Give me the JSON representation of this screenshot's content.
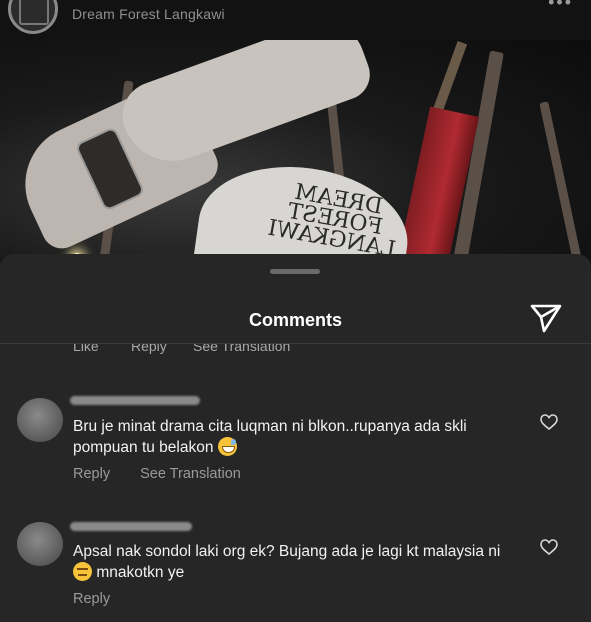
{
  "post": {
    "location": "Dream Forest Langkawi",
    "more_icon": "more-horizontal-icon"
  },
  "photo": {
    "cap_text": "DREAM FOREST LANGKAWI"
  },
  "sheet": {
    "title": "Comments",
    "send_icon": "send-icon",
    "clipped_actions": [
      "Like",
      "Reply",
      "See Translation"
    ]
  },
  "comments": [
    {
      "text_before_emoji": "Bru je minat drama cita luqman ni blkon..rupanya ada skli pompuan tu belakon",
      "emoji": "grinning-sweat-emoji",
      "text_after_emoji": "",
      "actions": [
        "Reply",
        "See Translation"
      ],
      "like_icon": "heart-icon"
    },
    {
      "text_before_emoji": "Apsal nak sondol laki org ek? Bujang ada je lagi kt malaysia ni",
      "emoji": "unamused-emoji",
      "text_after_emoji": " mnakotkn ye",
      "actions": [
        "Reply"
      ],
      "like_icon": "heart-icon"
    }
  ],
  "colors": {
    "sheet_bg": "#262626",
    "text": "#f2f2f2",
    "muted": "#9a9a9a"
  }
}
